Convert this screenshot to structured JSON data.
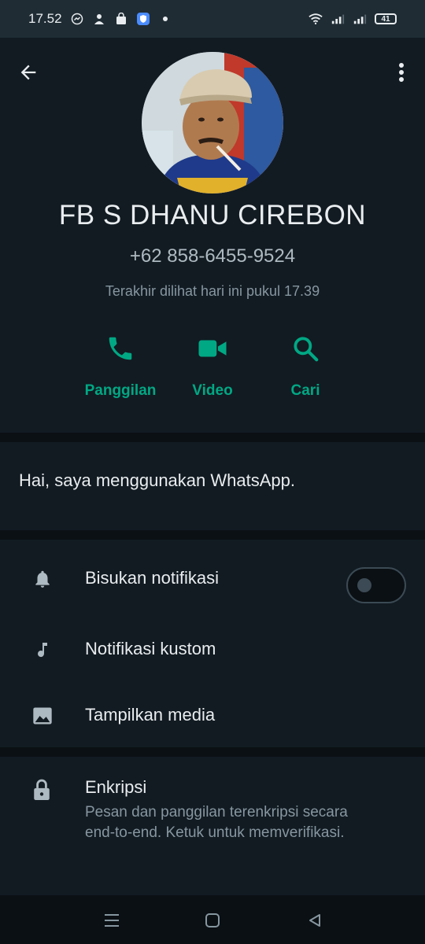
{
  "status_bar": {
    "time": "17.52",
    "battery": "41"
  },
  "contact": {
    "name": "FB S DHANU CIREBON",
    "phone": "+62 858-6455-9524",
    "last_seen": "Terakhir dilihat hari ini pukul 17.39"
  },
  "actions": [
    {
      "label": "Panggilan",
      "icon": "phone-icon"
    },
    {
      "label": "Video",
      "icon": "video-icon"
    },
    {
      "label": "Cari",
      "icon": "search-icon"
    }
  ],
  "about": {
    "text": "Hai, saya menggunakan WhatsApp."
  },
  "settings": [
    {
      "label": "Bisukan notifikasi",
      "icon": "bell-icon",
      "toggle": false
    },
    {
      "label": "Notifikasi kustom",
      "icon": "music-note-icon"
    },
    {
      "label": "Tampilkan media",
      "icon": "image-icon"
    }
  ],
  "encryption": {
    "title": "Enkripsi",
    "description": "Pesan dan panggilan terenkripsi secara end-to-end. Ketuk untuk memverifikasi."
  },
  "colors": {
    "accent": "#00a884",
    "background": "#0b1014",
    "surface": "#121b22",
    "status_bar": "#1f2c34"
  }
}
